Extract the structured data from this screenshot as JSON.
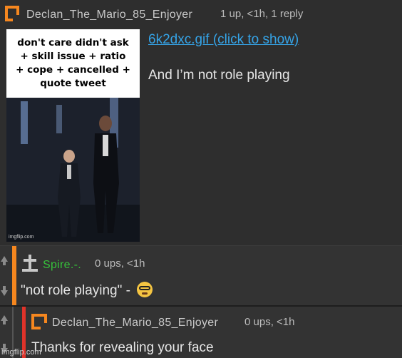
{
  "comments": [
    {
      "username": "Declan_The_Mario_85_Enjoyer",
      "meta": "1 up, <1h, 1 reply",
      "link": "6k2dxc.gif (click to show)",
      "text": "And I’m not role playing",
      "gif": {
        "caption_lines": [
          "don't care didn't ask",
          "+ skill issue + ratio",
          "+ cope + cancelled +",
          "quote tweet"
        ],
        "watermark": "imgflip.com"
      }
    },
    {
      "username": "Spire.-.",
      "meta": "0 ups, <1h",
      "text": "\"not role playing\" -",
      "emoji": "nerd-face-emoji",
      "accent": "#f6871f",
      "username_color": "#36c13a"
    },
    {
      "username": "Declan_The_Mario_85_Enjoyer",
      "meta": "0 ups, <1h",
      "text": "Thanks for revealing your face",
      "accent": "#e0332a"
    }
  ],
  "site_watermark": "imgflip.com",
  "colors": {
    "background": "#2c2c2c",
    "link": "#35a4e8",
    "orange": "#f6871f"
  }
}
